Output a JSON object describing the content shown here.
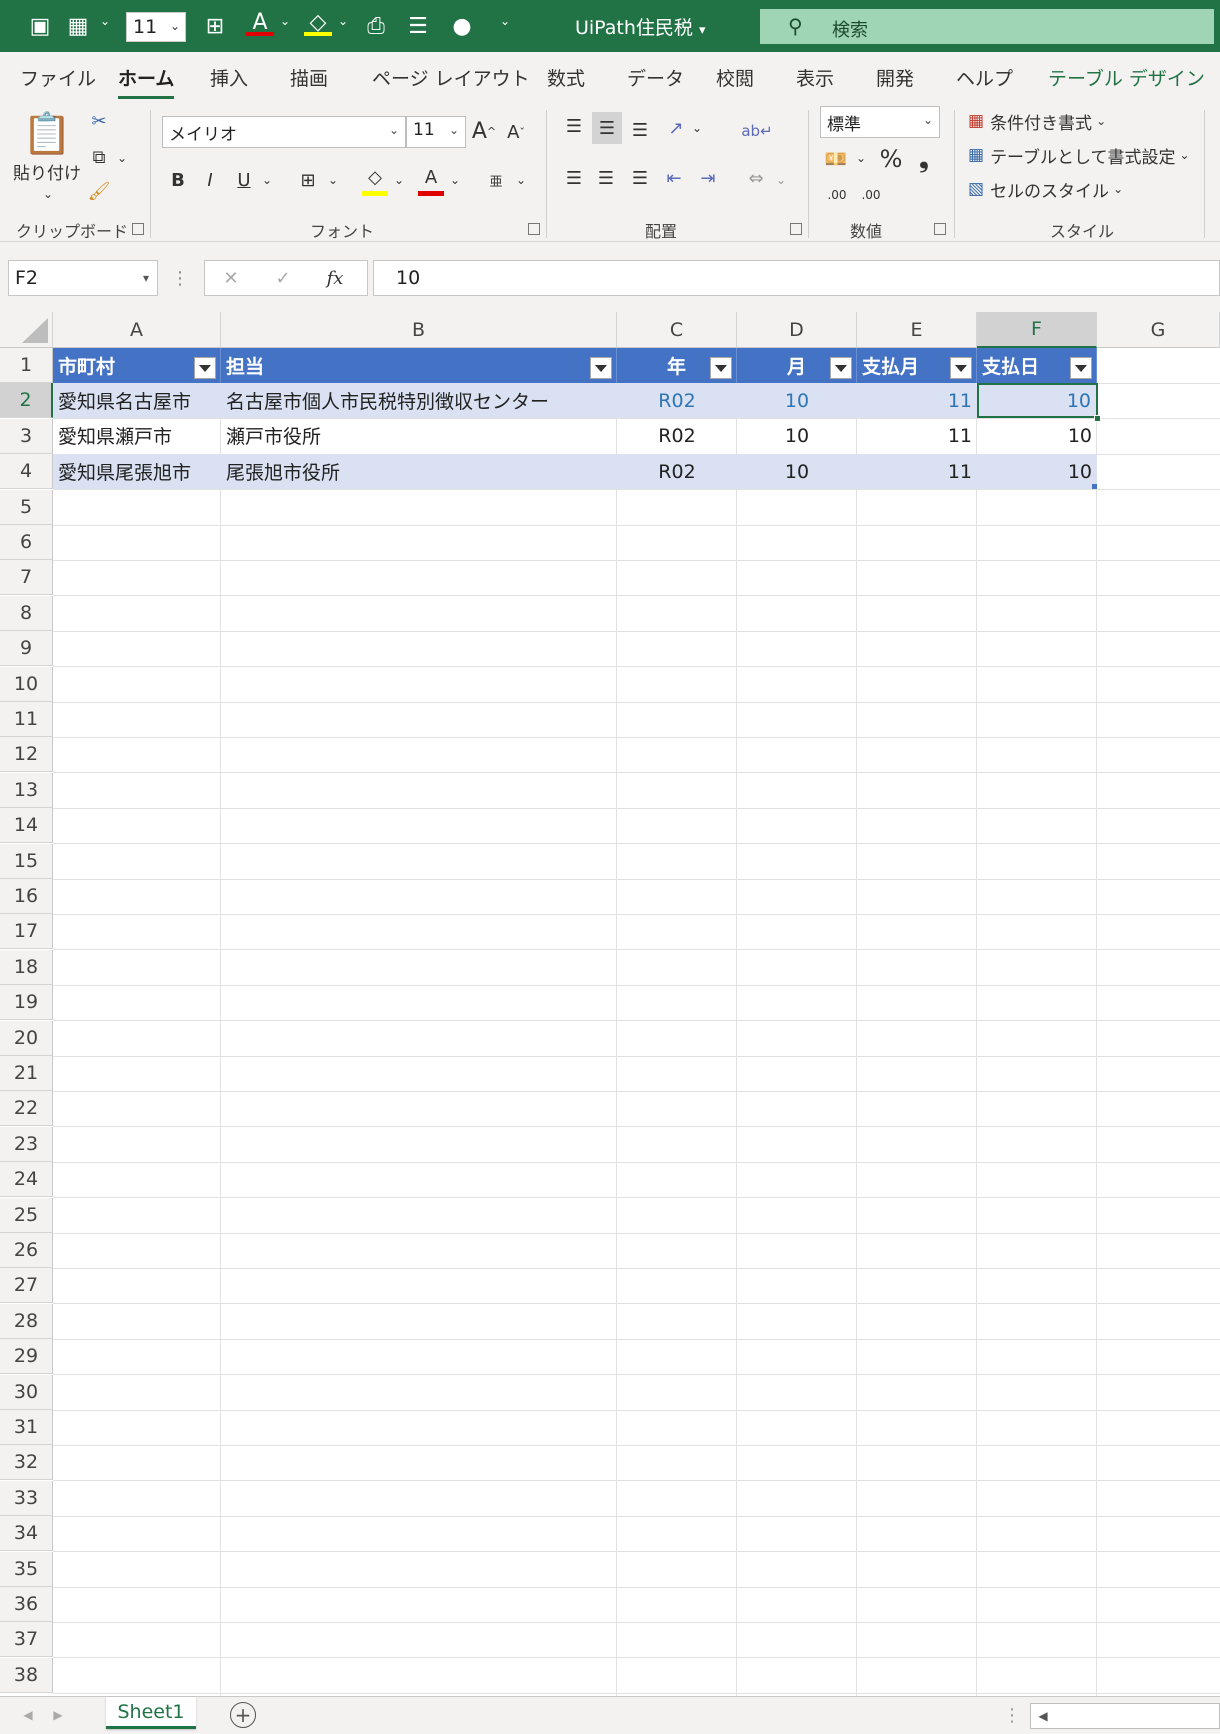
{
  "quick_access": {
    "font_size": "11",
    "doc_title": "UiPath住民税"
  },
  "search": {
    "label": "検索"
  },
  "tabs": [
    "ファイル",
    "ホーム",
    "挿入",
    "描画",
    "ページ レイアウト",
    "数式",
    "データ",
    "校閲",
    "表示",
    "開発",
    "ヘルプ",
    "テーブル デザイン"
  ],
  "ribbon": {
    "clipboard": {
      "paste_label": "貼り付け",
      "group_label": "クリップボード"
    },
    "font": {
      "font_name": "メイリオ",
      "font_size": "11",
      "group_label": "フォント",
      "bold": "B",
      "italic": "I",
      "underline": "U",
      "grow": "A",
      "shrink": "A"
    },
    "alignment": {
      "group_label": "配置"
    },
    "number": {
      "format": "標準",
      "percent": "%",
      "comma": "❟",
      "inc_decimal": ".00",
      "dec_decimal": ".00",
      "group_label": "数値"
    },
    "styles": {
      "conditional": "条件付き書式",
      "table_format": "テーブルとして書式設定",
      "cell_styles": "セルのスタイル",
      "group_label": "スタイル"
    }
  },
  "formula_bar": {
    "name_box": "F2",
    "fx": "fx",
    "value": "10"
  },
  "columns": [
    "A",
    "B",
    "C",
    "D",
    "E",
    "F",
    "G"
  ],
  "table": {
    "headers": [
      "市町村",
      "担当",
      "年",
      "月",
      "支払月",
      "支払日"
    ],
    "rows": [
      [
        "愛知県名古屋市",
        "名古屋市個人市民税特別徴収センター",
        "R02",
        "10",
        "11",
        "10"
      ],
      [
        "愛知県瀬戸市",
        "瀬戸市役所",
        "R02",
        "10",
        "11",
        "10"
      ],
      [
        "愛知県尾張旭市",
        "尾張旭市役所",
        "R02",
        "10",
        "11",
        "10"
      ]
    ]
  },
  "row_numbers": [
    "1",
    "2",
    "3",
    "4",
    "5",
    "6",
    "7",
    "8",
    "9",
    "10",
    "11",
    "12",
    "13",
    "14",
    "15",
    "16",
    "17",
    "18",
    "19",
    "20",
    "21",
    "22",
    "23",
    "24",
    "25",
    "26",
    "27",
    "28",
    "29",
    "30",
    "31",
    "32",
    "33",
    "34",
    "35",
    "36",
    "37",
    "38"
  ],
  "selected_cell": "F2",
  "sheet_tab": "Sheet1",
  "colors": {
    "excel_green": "#217346",
    "table_header": "#4472c4",
    "table_band": "#d9e1f2",
    "selected_text": "#2e75b6"
  }
}
